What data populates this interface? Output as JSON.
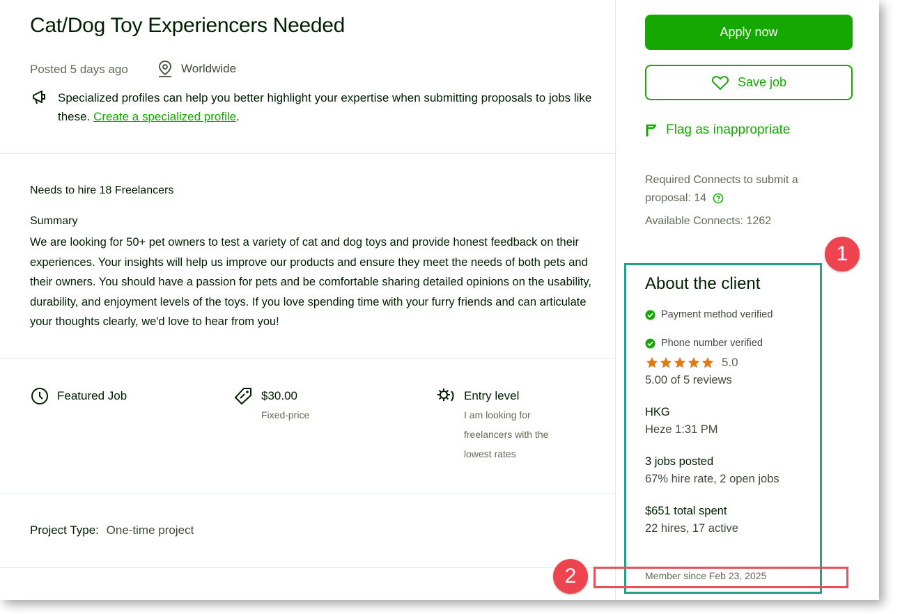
{
  "job": {
    "title": "Cat/Dog Toy Experiencers Needed",
    "posted": "Posted 5 days ago",
    "location": "Worldwide",
    "tip_text": "Specialized profiles can help you better highlight your expertise when submitting proposals to jobs like these.",
    "tip_link": "Create a specialized profile",
    "tip_end": ".",
    "hire_count": "Needs to hire 18 Freelancers",
    "summary_heading": "Summary",
    "summary": "We are looking for 50+ pet owners to test a variety of cat and dog toys and provide honest feedback on their experiences. Your insights will help us improve our products and ensure they meet the needs of both pets and their owners. You should have a passion for pets and be comfortable sharing detailed opinions on the usability, durability, and enjoyment levels of the toys. If you love spending time with your furry friends and can articulate your thoughts clearly, we'd love to hear from you!",
    "features": {
      "featured": "Featured Job",
      "price": "$30.00",
      "price_type": "Fixed-price",
      "level": "Entry level",
      "level_desc_1": "I am looking for",
      "level_desc_2": "freelancers with the",
      "level_desc_3": "lowest rates"
    },
    "project_type_label": "Project Type:",
    "project_type_value": "One-time project"
  },
  "sidebar": {
    "apply_label": "Apply now",
    "save_label": "Save job",
    "flag_label": "Flag as inappropriate",
    "connects_required": "Required Connects to submit a proposal: 14",
    "connects_available": "Available Connects: 1262"
  },
  "client": {
    "heading": "About the client",
    "payment_verified": "Payment method verified",
    "phone_verified": "Phone number verified",
    "rating": "5.0",
    "rating_stars": 5,
    "reviews": "5.00 of 5 reviews",
    "country": "HKG",
    "local_time": "Heze 1:31 PM",
    "jobs_posted": "3 jobs posted",
    "hire_rate": "67% hire rate, 2 open jobs",
    "total_spent": "$651 total spent",
    "hires": "22 hires, 17 active",
    "member_since": "Member since Feb 23, 2025"
  },
  "annotations": {
    "badge_1": "1",
    "badge_2": "2"
  },
  "colors": {
    "brand_green": "#14a800",
    "star_orange": "#e07b12",
    "highlight_teal": "#26a08a",
    "highlight_red": "#e8505b"
  }
}
